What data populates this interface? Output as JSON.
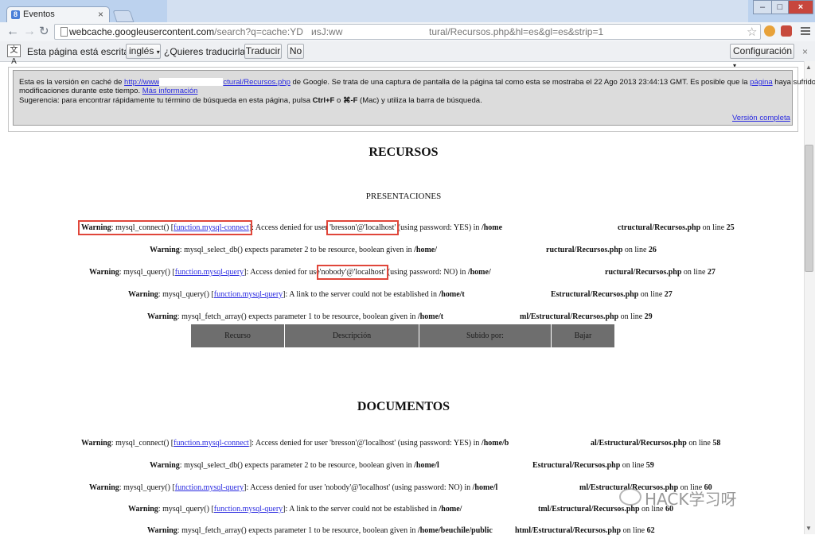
{
  "browser": {
    "tab_title": "Eventos",
    "favicon": "g-favicon",
    "url_host": "webcache.googleusercontent.com",
    "url_part1": "/search?q=cache:YD",
    "url_part2": "иsJ:ww",
    "url_part3": "tural/Recursos.php&hl=es&gl=es&strip=1"
  },
  "translate_bar": {
    "prefix": "Esta página está escrita en",
    "language": "inglés",
    "question": "¿Quieres traducirla?",
    "translate_label": "Traducir",
    "no_label": "No",
    "settings_label": "Configuración"
  },
  "cache_banner": {
    "line1_a": "Esta es la versión en caché de",
    "line1_link_a": "http://www",
    "line1_link_b": "ctural/Recursos.php",
    "line1_b": "de Google. Se trata de una captura de pantalla de la página tal como esta se mostraba el 22 Ago 2013 23:44:13 GMT. Es posible que la",
    "line1_link_c": "página",
    "line1_c": "haya sufrido",
    "line2_a": "modificaciones durante este tiempo.",
    "line2_link": "Más información",
    "line3_a": "Sugerencia: para encontrar rápidamente tu término de búsqueda en esta página, pulsa",
    "line3_key1": "Ctrl+F",
    "line3_b": "o",
    "line3_key2": "⌘-F",
    "line3_c": "(Mac) y utiliza la barra de búsqueda.",
    "full_version_link": "Versión completa"
  },
  "page": {
    "heading_recursos": "RECURSOS",
    "subheading_presentaciones": "PRESENTACIONES",
    "heading_documentos": "DOCUMENTOS",
    "table_headers": [
      "Recurso",
      "Descripción",
      "Subido por:",
      "Bajar"
    ],
    "common": {
      "warning": "Warning",
      "on_line": "on line",
      "mysql_connect_link": "function.mysql-connect",
      "mysql_query_link": "function.mysql-query"
    },
    "warnings_1": [
      {
        "a": ": mysql_connect() [",
        "b": "]: Access denied for user ",
        "user": "'bresson'@'localhost'",
        "c": " (using password: YES) in ",
        "path1": "/home",
        "path2": "ctructural/Recursos.php",
        "line": "25"
      },
      {
        "a": ": mysql_select_db() expects parameter 2 to be resource, boolean given in ",
        "path1": "/home/",
        "path2": "ructural/Recursos.php",
        "line": "26"
      },
      {
        "a": ": mysql_query() [",
        "b": "]: Access denied for use",
        "user": "'nobody'@'localhost'",
        "c": " (using password: NO) in ",
        "path1": "/home/",
        "path2": "ructural/Recursos.php",
        "line": "27"
      },
      {
        "a": ": mysql_query() [",
        "b": "]: A link to the server could not be established in ",
        "path1": "/home/t",
        "path2": "Estructural/Recursos.php",
        "line": "27"
      },
      {
        "a": ": mysql_fetch_array() expects parameter 1 to be resource, boolean given in ",
        "path1": "/home/t",
        "path2": "ml/Estructural/Recursos.php",
        "line": "29"
      }
    ],
    "warnings_2": [
      {
        "a": ": mysql_connect() [",
        "b": "]: Access denied for user 'bresson'@'localhost' (using password: YES) in ",
        "path1": "/home/b",
        "path2": "al/Estructural/Recursos.php",
        "line": "58"
      },
      {
        "a": ": mysql_select_db() expects parameter 2 to be resource, boolean given in ",
        "path1": "/home/l",
        "path2": "Estructural/Recursos.php",
        "line": "59"
      },
      {
        "a": ": mysql_query() [",
        "b": "]: Access denied for user 'nobody'@'localhost' (using password: NO) in ",
        "path1": "/home/l",
        "path2": "ml/Estructural/Recursos.php",
        "line": "60"
      },
      {
        "a": ": mysql_query() [",
        "b": "]: A link to the server could not be established in ",
        "path1": "/home/",
        "path2": "tml/Estructural/Recursos.php",
        "line": "60"
      },
      {
        "a": ": mysql_fetch_array() expects parameter 1 to be resource, boolean given in ",
        "path1": "/home/beuchile/public",
        "path2": "html/Estructural/Recursos.php",
        "line": "62"
      }
    ]
  },
  "watermark": {
    "text": "HACK学习呀"
  },
  "colors": {
    "highlight": "#e0463a",
    "link": "#2a2ae0",
    "table_header_bg": "#6e6e6e",
    "banner_bg": "#dcdcdc"
  }
}
